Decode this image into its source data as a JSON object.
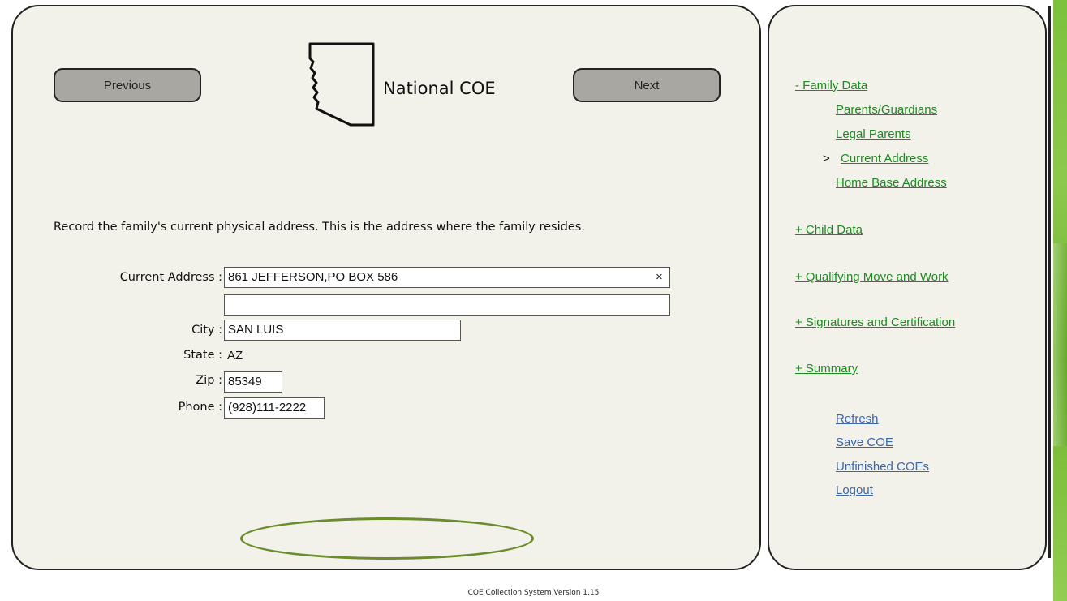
{
  "header": {
    "previous_label": "Previous",
    "next_label": "Next",
    "title": "National COE"
  },
  "instructions": "Record the family's current physical address. This is the address where the family resides.",
  "form": {
    "current_address_label": "Current Address :",
    "current_address_line1": "861 JEFFERSON,PO BOX 586",
    "current_address_line2": "",
    "clear_icon": "×",
    "city_label": "City :",
    "city_value": "SAN LUIS",
    "state_label": "State :",
    "state_value": "AZ",
    "zip_label": "Zip :",
    "zip_value": "85349",
    "phone_label": "Phone :",
    "phone_value": "(928)111-2222"
  },
  "sidebar": {
    "family_data": "- Family Data",
    "family_items": [
      {
        "label": "Parents/Guardians",
        "current": false
      },
      {
        "label": "Legal Parents",
        "current": false
      },
      {
        "label": "Current Address",
        "current": true,
        "marker": ">"
      },
      {
        "label": "Home Base Address",
        "current": false
      }
    ],
    "child_data": "+ Child Data",
    "qualifying_move": "+ Qualifying Move and Work",
    "signatures": "+ Signatures and Certification",
    "summary": "+ Summary",
    "actions": [
      "Refresh",
      "Save COE",
      "Unfinished COEs",
      "Logout"
    ]
  },
  "footer": {
    "version": "COE Collection System Version 1.15"
  },
  "colors": {
    "panel_bg": "#f2f1ea",
    "link_green": "#1e8a22",
    "link_blue": "#3a67a8",
    "oval_green": "#6a8c2c"
  }
}
